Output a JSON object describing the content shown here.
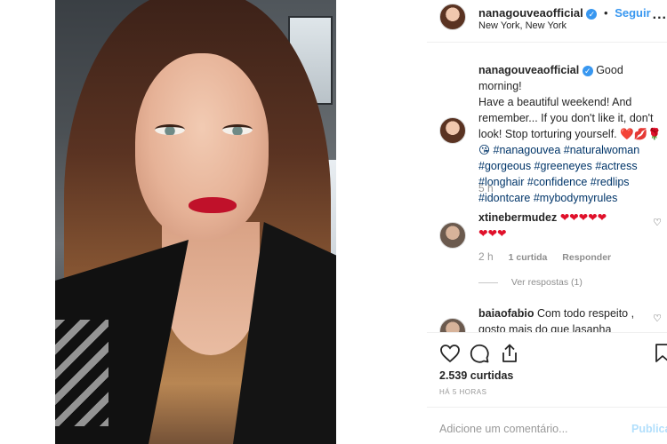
{
  "post": {
    "username": "nanagouveaofficial",
    "follow_label": "Seguir",
    "location": "New York, New York",
    "more_label": "..."
  },
  "caption": {
    "username": "nanagouveaofficial",
    "text_lines": [
      "Good morning!",
      "Have a beautiful weekend! And",
      "remember... If you don't like it, don't",
      "look! Stop torturing yourself. ❤️💋🌹",
      "😘 #nanagouvea #naturalwoman",
      "#gorgeous #greeneyes #actress",
      "#longhair #confidence #redlips",
      "#idontcare #mybodymyrules"
    ],
    "time": "5 h"
  },
  "comments": [
    {
      "username": "xtinebermudez",
      "text_line1": "❤❤❤❤❤",
      "text_line2": "❤❤❤",
      "time": "2 h",
      "likes": "1 curtida",
      "reply": "Responder",
      "view_replies": "Ver respostas (1)"
    },
    {
      "username": "baiaofabio",
      "text_line1": "Com todo respeito ,",
      "text_line2": "gosto mais do que lasanha"
    }
  ],
  "stats": {
    "likes": "2.539 curtidas",
    "ago": "HÁ 5 HORAS"
  },
  "comment_box": {
    "placeholder": "Adicione um comentário...",
    "publish": "Publicar"
  },
  "colors": {
    "accent_blue": "#3897f0",
    "hashtag": "#003569",
    "heart_red": "#e0102a"
  }
}
